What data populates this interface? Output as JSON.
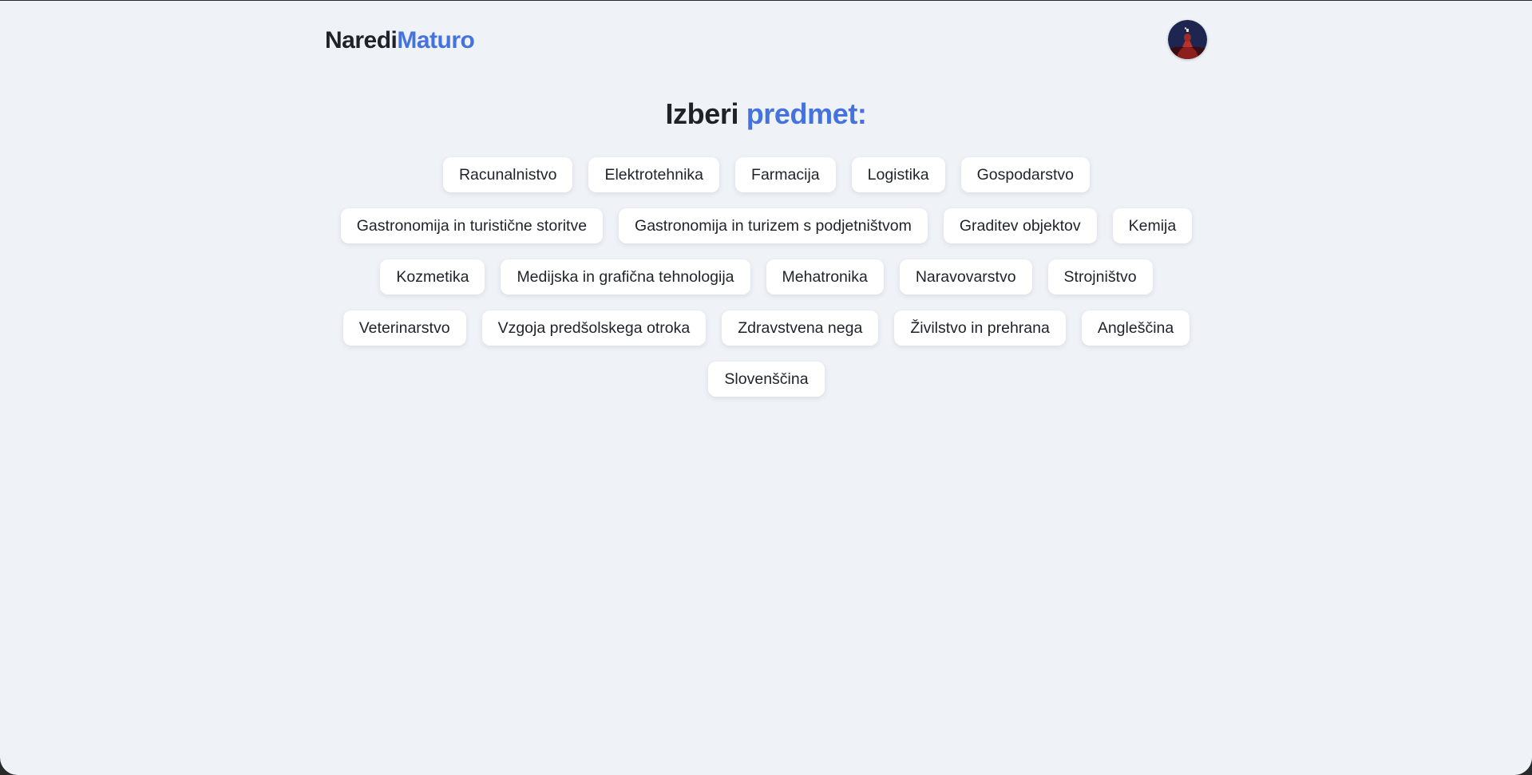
{
  "header": {
    "logo_part1": "Naredi",
    "logo_part2": "Maturo",
    "avatar_icon": "user-avatar-icon"
  },
  "main": {
    "title_part1": "Izberi",
    "title_part2": "predmet:"
  },
  "subjects": [
    [
      "Racunalnistvo",
      "Elektrotehnika",
      "Farmacija",
      "Logistika",
      "Gospodarstvo"
    ],
    [
      "Gastronomija in turistične storitve",
      "Gastronomija in turizem s podjetništvom",
      "Graditev objektov",
      "Kemija"
    ],
    [
      "Kozmetika",
      "Medijska in grafična tehnologija",
      "Mehatronika",
      "Naravovarstvo",
      "Strojništvo"
    ],
    [
      "Veterinarstvo",
      "Vzgoja predšolskega otroka",
      "Zdravstvena nega",
      "Živilstvo in prehrana",
      "Angleščina"
    ],
    [
      "Slovenščina"
    ]
  ],
  "colors": {
    "accent": "#4473df",
    "text": "#1f2329",
    "background": "#eff2f7",
    "chip": "#ffffff"
  }
}
